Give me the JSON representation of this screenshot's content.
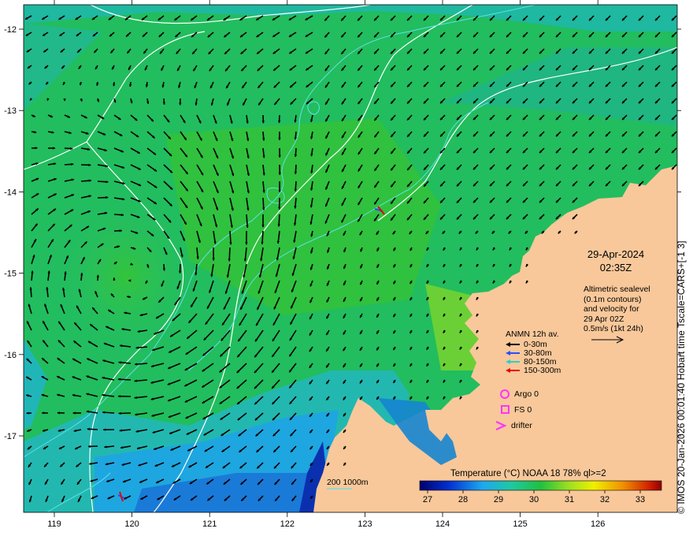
{
  "map": {
    "side_title": "© IMOS 20-Jan-2026 00:01:40 Hobart time Tscale=CARS+[-1 3]",
    "date": "29-Apr-2024",
    "time": "02:35Z",
    "info_lines": [
      "Altimetric sealevel",
      "(0.1m contours)",
      "and velocity for",
      "29 Apr 02Z",
      "0.5m/s (1kt 24h)"
    ],
    "anmn": {
      "title": "ANMN 12h av.",
      "entries": [
        {
          "label": "0-30m",
          "color": "#000000"
        },
        {
          "label": "30-80m",
          "color": "#2a4dff"
        },
        {
          "label": "80-150m",
          "color": "#33cccc"
        },
        {
          "label": "150-300m",
          "color": "#e60000"
        }
      ]
    },
    "argo_label": "Argo 0",
    "fs_label": "FS 0",
    "drifter_label": "drifter",
    "isobath_labels": [
      "200",
      "1000m"
    ],
    "colorbar": {
      "title": "Temperature (°C) NOAA 18 78% ql>=2",
      "ticks": [
        "27",
        "28",
        "29",
        "30",
        "31",
        "32",
        "33"
      ]
    },
    "lon_ticks": [
      "119",
      "120",
      "121",
      "122",
      "123",
      "124",
      "125",
      "126"
    ],
    "lat_ticks": [
      "-12",
      "-13",
      "-14",
      "-15",
      "-16",
      "-17"
    ],
    "colors": {
      "land": "#f8c89a",
      "sst_warm": "#1fbf3a",
      "sst_mid": "#18c070",
      "sst_cool": "#23a8e6",
      "sst_cold": "#1040c0",
      "contour": "#ffffff",
      "isobath": "#5fe0e8",
      "marker": "#ff33ff"
    }
  }
}
